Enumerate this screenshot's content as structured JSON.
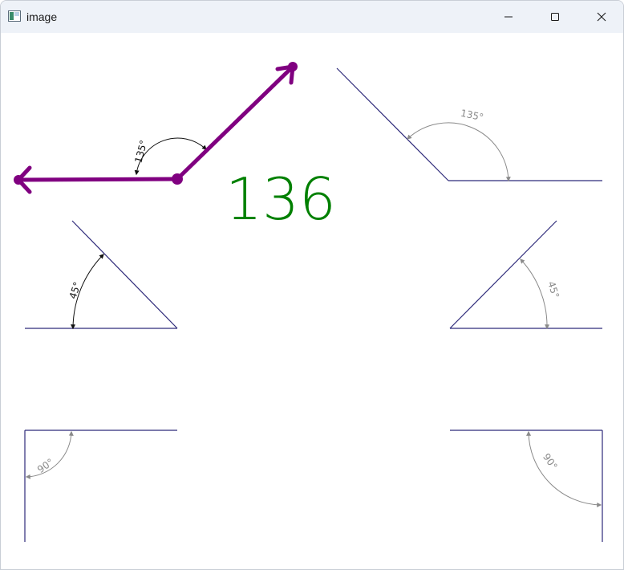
{
  "window": {
    "title": "image",
    "icons": {
      "app": "image-viewer-icon",
      "minimize": "minimize-icon",
      "maximize": "maximize-icon",
      "close": "close-icon"
    }
  },
  "canvas": {
    "measured_angle": "136",
    "colors": {
      "measure_vector": "#800080",
      "measured_angle_text": "#008000",
      "reference_lines": "#2e2a7a",
      "reference_arcs": "#8a8a8a",
      "active_arc": "#111111"
    },
    "reference_angles": [
      {
        "label": "135°"
      },
      {
        "label": "45°"
      },
      {
        "label": "45°"
      },
      {
        "label": "90°"
      },
      {
        "label": "90°"
      }
    ],
    "measure_vector_label": "135°"
  }
}
